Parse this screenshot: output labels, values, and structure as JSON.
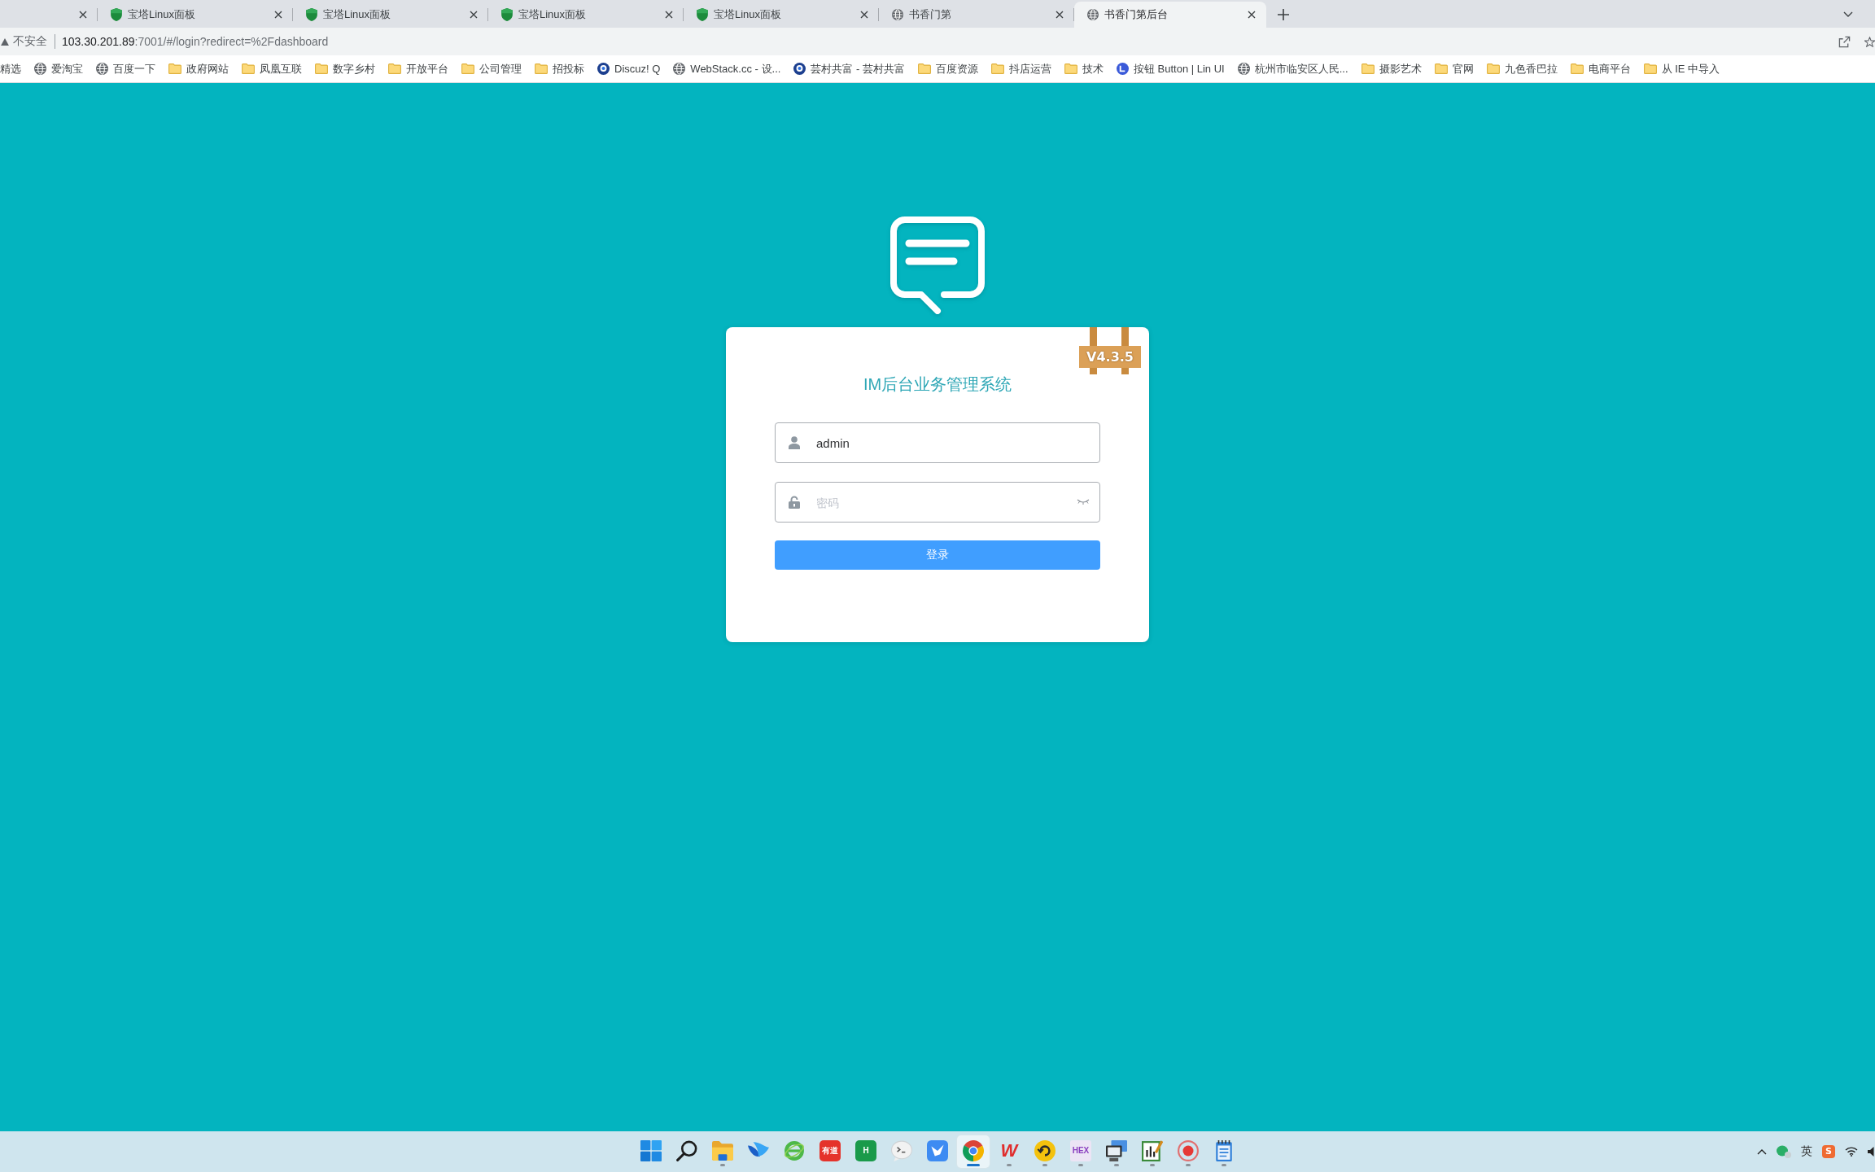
{
  "browser": {
    "tabs": [
      {
        "selected": false
      },
      {
        "kind": "shield",
        "title": "宝塔Linux面板",
        "selected": false
      },
      {
        "kind": "shield",
        "title": "宝塔Linux面板",
        "selected": false
      },
      {
        "kind": "shield",
        "title": "宝塔Linux面板",
        "selected": false
      },
      {
        "kind": "shield",
        "title": "宝塔Linux面板",
        "selected": false
      },
      {
        "kind": "globe",
        "title": "书香门第",
        "selected": false
      },
      {
        "kind": "globe",
        "title": "书香门第后台",
        "selected": true
      }
    ],
    "address_bar": {
      "security_label": "不安全",
      "host": "103.30.201.89",
      "path": ":7001/#/login?redirect=%2Fdashboard"
    },
    "bookmarks": [
      {
        "label": "精选"
      },
      {
        "kind": "globe",
        "label": "爱淘宝"
      },
      {
        "kind": "globe",
        "label": "百度一下"
      },
      {
        "kind": "folder",
        "label": "政府网站"
      },
      {
        "kind": "folder",
        "label": "凤凰互联"
      },
      {
        "kind": "folder",
        "label": "数字乡村"
      },
      {
        "kind": "folder",
        "label": "开放平台"
      },
      {
        "kind": "folder",
        "label": "公司管理"
      },
      {
        "kind": "folder",
        "label": "招投标"
      },
      {
        "kind": "ring",
        "label": "Discuz! Q"
      },
      {
        "kind": "globe",
        "label": "WebStack.cc - 设..."
      },
      {
        "kind": "ring",
        "label": "芸村共富 - 芸村共富"
      },
      {
        "kind": "folder",
        "label": "百度资源"
      },
      {
        "kind": "folder",
        "label": "抖店运营"
      },
      {
        "kind": "folder",
        "label": "技术"
      },
      {
        "kind": "disc",
        "label": "按钮 Button | Lin UI"
      },
      {
        "kind": "globe",
        "label": "杭州市临安区人民..."
      },
      {
        "kind": "folder",
        "label": "摄影艺术"
      },
      {
        "kind": "folder",
        "label": "官网"
      },
      {
        "kind": "folder",
        "label": "九色香巴拉"
      },
      {
        "kind": "folder",
        "label": "电商平台"
      },
      {
        "kind": "folder",
        "label": "从 IE 中导入"
      }
    ]
  },
  "login": {
    "version_badge": "V4.3.5",
    "title": "IM后台业务管理系统",
    "username": {
      "value": "admin"
    },
    "password": {
      "placeholder": "密码"
    },
    "submit": "登录"
  },
  "taskbar": {
    "apps": [
      {
        "kind": "start",
        "running": false,
        "selected": false
      },
      {
        "kind": "search",
        "running": false,
        "selected": false
      },
      {
        "kind": "folder",
        "running": true,
        "selected": false
      },
      {
        "kind": "wing",
        "running": false,
        "selected": false
      },
      {
        "kind": "e-browser",
        "running": false,
        "selected": false
      },
      {
        "kind": "tile",
        "glyph": "有道",
        "color": "#e5332b",
        "running": false,
        "selected": false
      },
      {
        "kind": "tile",
        "glyph": "H",
        "color": "#1a9a4a",
        "running": false,
        "selected": false
      },
      {
        "kind": "bubble",
        "running": false,
        "selected": false
      },
      {
        "kind": "bird",
        "running": false,
        "selected": false
      },
      {
        "kind": "chrome",
        "running": true,
        "selected": true
      },
      {
        "kind": "letter",
        "glyph": "W",
        "color": "#e02d2d",
        "running": true,
        "selected": false
      },
      {
        "kind": "sync",
        "running": true,
        "selected": false
      },
      {
        "kind": "letter",
        "glyph": "HEX",
        "color": "#8a3fbf",
        "running": true,
        "selected": false
      },
      {
        "kind": "monitor",
        "running": true,
        "selected": false
      },
      {
        "kind": "chart",
        "running": true,
        "selected": false
      },
      {
        "kind": "record",
        "running": true,
        "selected": false
      },
      {
        "kind": "notepad",
        "running": true,
        "selected": false
      }
    ],
    "tray": [
      {
        "kind": "chevron"
      },
      {
        "kind": "app"
      },
      {
        "kind": "text",
        "label": "英"
      },
      {
        "kind": "tile",
        "glyph": "S",
        "color": "#ef6b32"
      },
      {
        "kind": "wifi"
      },
      {
        "kind": "speaker"
      }
    ]
  }
}
